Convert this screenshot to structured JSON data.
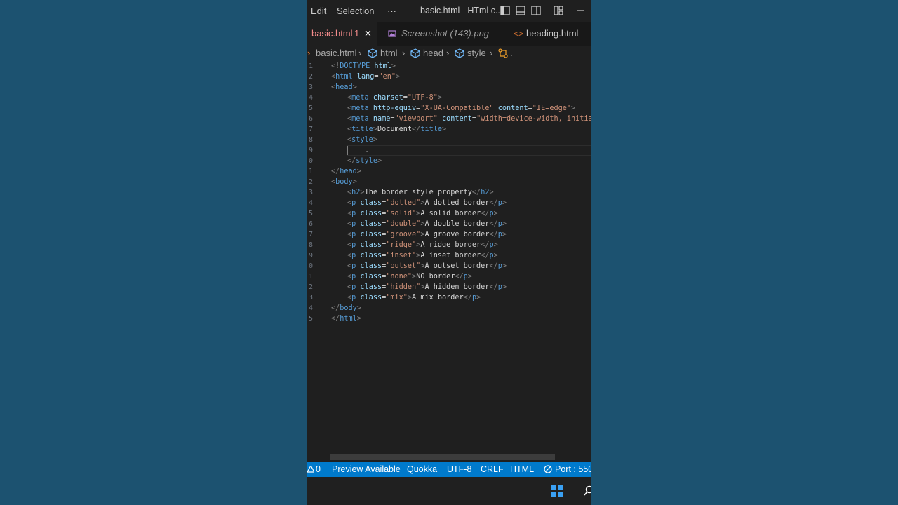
{
  "menu": {
    "edit": "Edit",
    "selection": "Selection",
    "more": "···"
  },
  "window": {
    "title": "basic.html - HTml c..."
  },
  "tabs": [
    {
      "label": "basic.html",
      "badge": "1",
      "close": "✕"
    },
    {
      "label": "Screenshot (143).png"
    },
    {
      "label": "heading.html"
    }
  ],
  "breadcrumb": {
    "file": "basic.html",
    "html": "html",
    "head": "head",
    "style": "style",
    "current": "."
  },
  "code_lines": [
    {
      "n": "1",
      "indent": 0,
      "parts": [
        [
          "t",
          "<!"
        ],
        [
          "tn",
          "DOCTYPE"
        ],
        [
          "an",
          " html"
        ],
        [
          "t",
          ">"
        ]
      ]
    },
    {
      "n": "2",
      "indent": 0,
      "parts": [
        [
          "t",
          "<"
        ],
        [
          "tn",
          "html"
        ],
        [
          "an",
          " lang"
        ],
        [
          "tx",
          "="
        ],
        [
          "av",
          "\"en\""
        ],
        [
          "t",
          ">"
        ]
      ]
    },
    {
      "n": "3",
      "indent": 0,
      "parts": [
        [
          "t",
          "<"
        ],
        [
          "tn",
          "head"
        ],
        [
          "t",
          ">"
        ]
      ]
    },
    {
      "n": "4",
      "indent": 1,
      "parts": [
        [
          "t",
          "<"
        ],
        [
          "tn",
          "meta"
        ],
        [
          "an",
          " charset"
        ],
        [
          "tx",
          "="
        ],
        [
          "av",
          "\"UTF-8\""
        ],
        [
          "t",
          ">"
        ]
      ]
    },
    {
      "n": "5",
      "indent": 1,
      "parts": [
        [
          "t",
          "<"
        ],
        [
          "tn",
          "meta"
        ],
        [
          "an",
          " http-equiv"
        ],
        [
          "tx",
          "="
        ],
        [
          "av",
          "\"X-UA-Compatible\""
        ],
        [
          "an",
          " content"
        ],
        [
          "tx",
          "="
        ],
        [
          "av",
          "\"IE=edge\""
        ],
        [
          "t",
          ">"
        ]
      ]
    },
    {
      "n": "6",
      "indent": 1,
      "parts": [
        [
          "t",
          "<"
        ],
        [
          "tn",
          "meta"
        ],
        [
          "an",
          " name"
        ],
        [
          "tx",
          "="
        ],
        [
          "av",
          "\"viewport\""
        ],
        [
          "an",
          " content"
        ],
        [
          "tx",
          "="
        ],
        [
          "av",
          "\"width=device-width, initial"
        ]
      ]
    },
    {
      "n": "7",
      "indent": 1,
      "parts": [
        [
          "t",
          "<"
        ],
        [
          "tn",
          "title"
        ],
        [
          "t",
          ">"
        ],
        [
          "tx",
          "Document"
        ],
        [
          "t",
          "</"
        ],
        [
          "tn",
          "title"
        ],
        [
          "t",
          ">"
        ]
      ]
    },
    {
      "n": "8",
      "indent": 1,
      "parts": [
        [
          "t",
          "<"
        ],
        [
          "tn",
          "style"
        ],
        [
          "t",
          ">"
        ]
      ]
    },
    {
      "n": "9",
      "indent": 2,
      "parts": [
        [
          "tx",
          "."
        ]
      ]
    },
    {
      "n": "0",
      "indent": 1,
      "parts": [
        [
          "t",
          "</"
        ],
        [
          "tn",
          "style"
        ],
        [
          "t",
          ">"
        ]
      ]
    },
    {
      "n": "1",
      "indent": 0,
      "parts": [
        [
          "t",
          "</"
        ],
        [
          "tn",
          "head"
        ],
        [
          "t",
          ">"
        ]
      ]
    },
    {
      "n": "2",
      "indent": 0,
      "parts": [
        [
          "t",
          "<"
        ],
        [
          "tn",
          "body"
        ],
        [
          "t",
          ">"
        ]
      ]
    },
    {
      "n": "3",
      "indent": 1,
      "parts": [
        [
          "t",
          "<"
        ],
        [
          "tn",
          "h2"
        ],
        [
          "t",
          ">"
        ],
        [
          "tx",
          "The border style property"
        ],
        [
          "t",
          "</"
        ],
        [
          "tn",
          "h2"
        ],
        [
          "t",
          ">"
        ]
      ]
    },
    {
      "n": "4",
      "indent": 1,
      "parts": [
        [
          "t",
          "<"
        ],
        [
          "tn",
          "p"
        ],
        [
          "an",
          " class"
        ],
        [
          "tx",
          "="
        ],
        [
          "av",
          "\"dotted\""
        ],
        [
          "t",
          ">"
        ],
        [
          "tx",
          "A dotted border"
        ],
        [
          "t",
          "</"
        ],
        [
          "tn",
          "p"
        ],
        [
          "t",
          ">"
        ]
      ]
    },
    {
      "n": "5",
      "indent": 1,
      "parts": [
        [
          "t",
          "<"
        ],
        [
          "tn",
          "p"
        ],
        [
          "an",
          " class"
        ],
        [
          "tx",
          "="
        ],
        [
          "av",
          "\"solid\""
        ],
        [
          "t",
          ">"
        ],
        [
          "tx",
          "A solid border"
        ],
        [
          "t",
          "</"
        ],
        [
          "tn",
          "p"
        ],
        [
          "t",
          ">"
        ]
      ]
    },
    {
      "n": "6",
      "indent": 1,
      "parts": [
        [
          "t",
          "<"
        ],
        [
          "tn",
          "p"
        ],
        [
          "an",
          " class"
        ],
        [
          "tx",
          "="
        ],
        [
          "av",
          "\"double\""
        ],
        [
          "t",
          ">"
        ],
        [
          "tx",
          "A double border"
        ],
        [
          "t",
          "</"
        ],
        [
          "tn",
          "p"
        ],
        [
          "t",
          ">"
        ]
      ]
    },
    {
      "n": "7",
      "indent": 1,
      "parts": [
        [
          "t",
          "<"
        ],
        [
          "tn",
          "p"
        ],
        [
          "an",
          " class"
        ],
        [
          "tx",
          "="
        ],
        [
          "av",
          "\"groove\""
        ],
        [
          "t",
          ">"
        ],
        [
          "tx",
          "A groove border"
        ],
        [
          "t",
          "</"
        ],
        [
          "tn",
          "p"
        ],
        [
          "t",
          ">"
        ]
      ]
    },
    {
      "n": "8",
      "indent": 1,
      "parts": [
        [
          "t",
          "<"
        ],
        [
          "tn",
          "p"
        ],
        [
          "an",
          " class"
        ],
        [
          "tx",
          "="
        ],
        [
          "av",
          "\"ridge\""
        ],
        [
          "t",
          ">"
        ],
        [
          "tx",
          "A ridge border"
        ],
        [
          "t",
          "</"
        ],
        [
          "tn",
          "p"
        ],
        [
          "t",
          ">"
        ]
      ]
    },
    {
      "n": "9",
      "indent": 1,
      "parts": [
        [
          "t",
          "<"
        ],
        [
          "tn",
          "p"
        ],
        [
          "an",
          " class"
        ],
        [
          "tx",
          "="
        ],
        [
          "av",
          "\"inset\""
        ],
        [
          "t",
          ">"
        ],
        [
          "tx",
          "A inset border"
        ],
        [
          "t",
          "</"
        ],
        [
          "tn",
          "p"
        ],
        [
          "t",
          ">"
        ]
      ]
    },
    {
      "n": "0",
      "indent": 1,
      "parts": [
        [
          "t",
          "<"
        ],
        [
          "tn",
          "p"
        ],
        [
          "an",
          " class"
        ],
        [
          "tx",
          "="
        ],
        [
          "av",
          "\"outset\""
        ],
        [
          "t",
          ">"
        ],
        [
          "tx",
          "A outset border"
        ],
        [
          "t",
          "</"
        ],
        [
          "tn",
          "p"
        ],
        [
          "t",
          ">"
        ]
      ]
    },
    {
      "n": "1",
      "indent": 1,
      "parts": [
        [
          "t",
          "<"
        ],
        [
          "tn",
          "p"
        ],
        [
          "an",
          " class"
        ],
        [
          "tx",
          "="
        ],
        [
          "av",
          "\"none\""
        ],
        [
          "t",
          ">"
        ],
        [
          "tx",
          "NO border"
        ],
        [
          "t",
          "</"
        ],
        [
          "tn",
          "p"
        ],
        [
          "t",
          ">"
        ]
      ]
    },
    {
      "n": "2",
      "indent": 1,
      "parts": [
        [
          "t",
          "<"
        ],
        [
          "tn",
          "p"
        ],
        [
          "an",
          " class"
        ],
        [
          "tx",
          "="
        ],
        [
          "av",
          "\"hidden\""
        ],
        [
          "t",
          ">"
        ],
        [
          "tx",
          "A hidden border"
        ],
        [
          "t",
          "</"
        ],
        [
          "tn",
          "p"
        ],
        [
          "t",
          ">"
        ]
      ]
    },
    {
      "n": "3",
      "indent": 1,
      "parts": [
        [
          "t",
          "<"
        ],
        [
          "tn",
          "p"
        ],
        [
          "an",
          " class"
        ],
        [
          "tx",
          "="
        ],
        [
          "av",
          "\"mix\""
        ],
        [
          "t",
          ">"
        ],
        [
          "tx",
          "A mix border"
        ],
        [
          "t",
          "</"
        ],
        [
          "tn",
          "p"
        ],
        [
          "t",
          ">"
        ]
      ]
    },
    {
      "n": "4",
      "indent": 0,
      "parts": [
        [
          "t",
          "</"
        ],
        [
          "tn",
          "body"
        ],
        [
          "t",
          ">"
        ]
      ]
    },
    {
      "n": "5",
      "indent": 0,
      "parts": [
        [
          "t",
          "</"
        ],
        [
          "tn",
          "html"
        ],
        [
          "t",
          ">"
        ]
      ]
    }
  ],
  "statusbar": {
    "problems": "0",
    "preview": "Preview Available",
    "quokka": "Quokka",
    "encoding": "UTF-8",
    "eol": "CRLF",
    "language": "HTML",
    "port": "Port : 550"
  },
  "colors": {
    "background": "#1c5270",
    "editor": "#1f1f1f",
    "statusbar": "#007acc",
    "tab_error": "#f38b8b"
  }
}
